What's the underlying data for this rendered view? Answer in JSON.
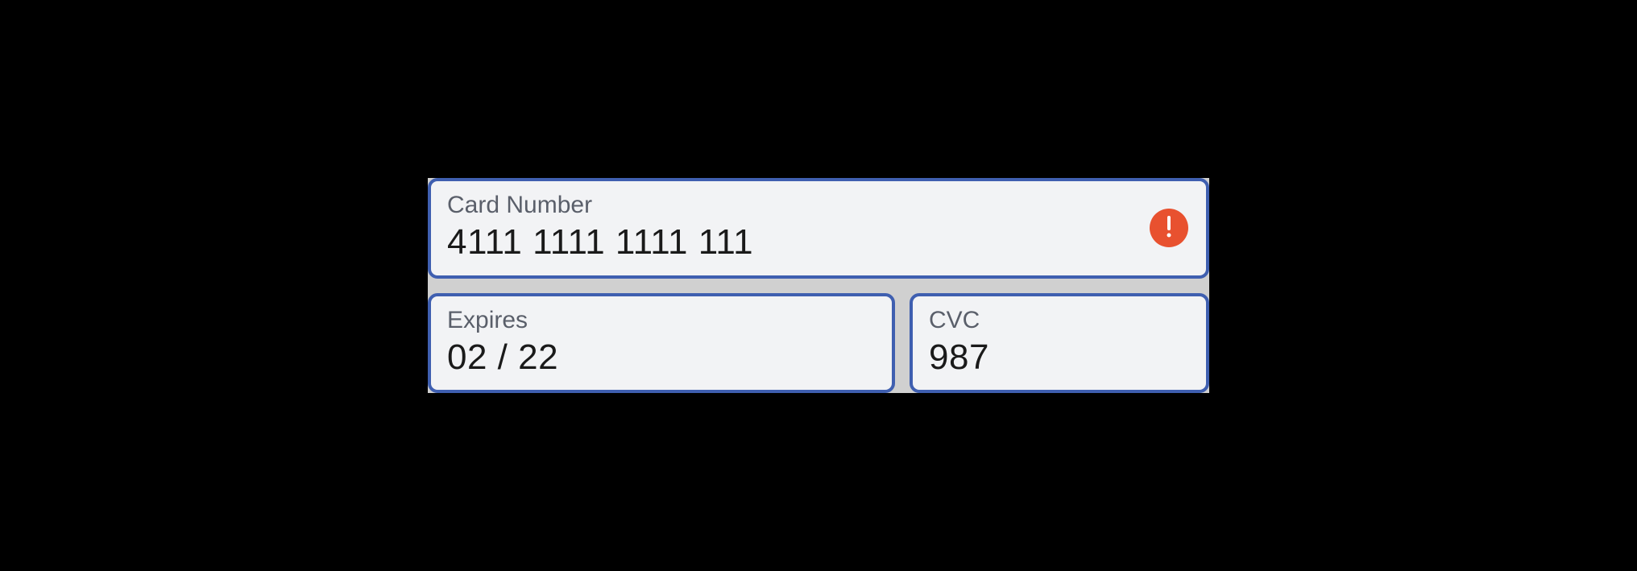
{
  "card": {
    "number_label": "Card Number",
    "number_value": "4111 1111 1111 111",
    "expires_label": "Expires",
    "expires_value": "02 / 22",
    "cvc_label": "CVC",
    "cvc_value": "987",
    "error_icon": "exclamation-icon"
  },
  "colors": {
    "border": "#3f5fb0",
    "field_bg": "#f2f3f5",
    "label": "#5a5f6a",
    "value": "#1a1a1a",
    "error": "#e8512f"
  }
}
